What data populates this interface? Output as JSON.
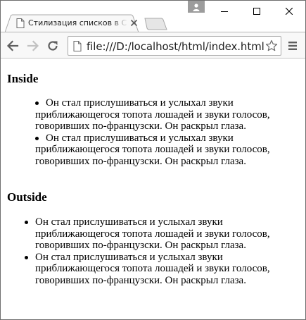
{
  "browser": {
    "tab_title": "Стилизация списков в CS",
    "url": "file:///D:/localhost/html/index.html"
  },
  "page": {
    "section_inside": {
      "heading": "Inside",
      "items": [
        "Он стал прислушиваться и услыхал звуки приближающегося топота лошадей и звуки голосов, говоривших по-французски. Он раскрыл глаза.",
        "Он стал прислушиваться и услыхал звуки приближающегося топота лошадей и звуки голосов, говоривших по-французски. Он раскрыл глаза."
      ]
    },
    "section_outside": {
      "heading": "Outside",
      "items": [
        "Он стал прислушиваться и услыхал звуки приближающегося топота лошадей и звуки голосов, говоривших по-французски. Он раскрыл глаза.",
        "Он стал прислушиваться и услыхал звуки приближающегося топота лошадей и звуки голосов, говоривших по-французски. Он раскрыл глаза."
      ]
    }
  },
  "icons": {
    "user": "user-icon",
    "minimize": "minimize-icon",
    "maximize": "maximize-icon",
    "close": "close-icon",
    "back": "arrow-left-icon",
    "forward": "arrow-right-icon",
    "reload": "reload-icon",
    "page": "page-icon",
    "bookmark": "star-icon",
    "menu": "hamburger-icon"
  }
}
